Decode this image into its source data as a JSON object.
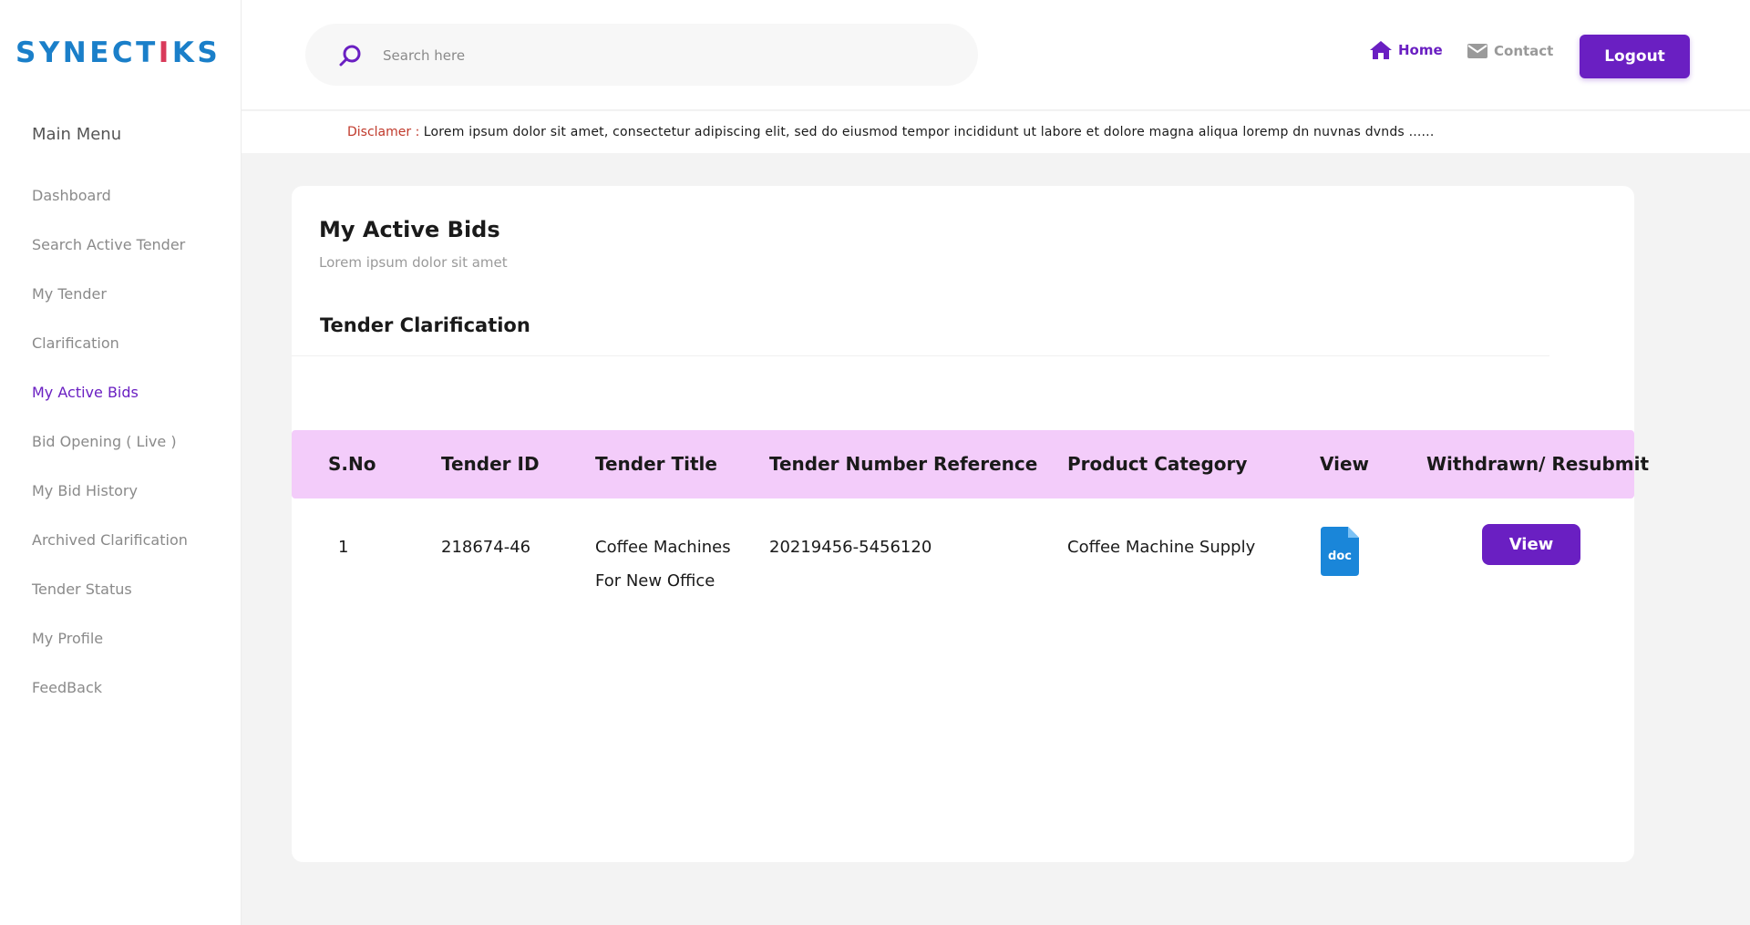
{
  "brand": {
    "logo_pre": "SYNECT",
    "logo_i": "I",
    "logo_post": "KS",
    "primary_color": "#6a1fc2",
    "logo_color": "#1a7fc9"
  },
  "sidebar": {
    "title": "Main Menu",
    "items": [
      {
        "label": "Dashboard"
      },
      {
        "label": "Search Active Tender"
      },
      {
        "label": "My Tender"
      },
      {
        "label": "Clarification"
      },
      {
        "label": "My Active Bids",
        "active": true
      },
      {
        "label": "Bid Opening ( Live )"
      },
      {
        "label": "My Bid History"
      },
      {
        "label": "Archived Clarification"
      },
      {
        "label": "Tender Status"
      },
      {
        "label": "My Profile"
      },
      {
        "label": "FeedBack"
      }
    ]
  },
  "header": {
    "search_placeholder": "Search here",
    "home_label": "Home",
    "contact_label": "Contact",
    "logout_label": "Logout"
  },
  "disclaimer": {
    "label": "Disclamer :",
    "text": "Lorem ipsum dolor sit amet, consectetur adipiscing elit, sed do eiusmod tempor incididunt ut labore et dolore magna aliqua loremp dn  nuvnas dvnds ......"
  },
  "page": {
    "title": "My Active Bids",
    "subtitle": "Lorem ipsum dolor sit amet",
    "section_title": "Tender Clarification"
  },
  "table": {
    "headers": [
      "S.No",
      "Tender ID",
      "Tender Title",
      "Tender Number Reference",
      "Product Category",
      "View",
      "Withdrawn/ Resubmit"
    ],
    "rows": [
      {
        "sno": "1",
        "tender_id": "218674-46",
        "title_line1": "Coffee Machines",
        "title_line2": "For New Office",
        "reference": "20219456-5456120",
        "category": "Coffee Machine Supply",
        "doc_label": "doc",
        "action_label": "View"
      }
    ]
  }
}
